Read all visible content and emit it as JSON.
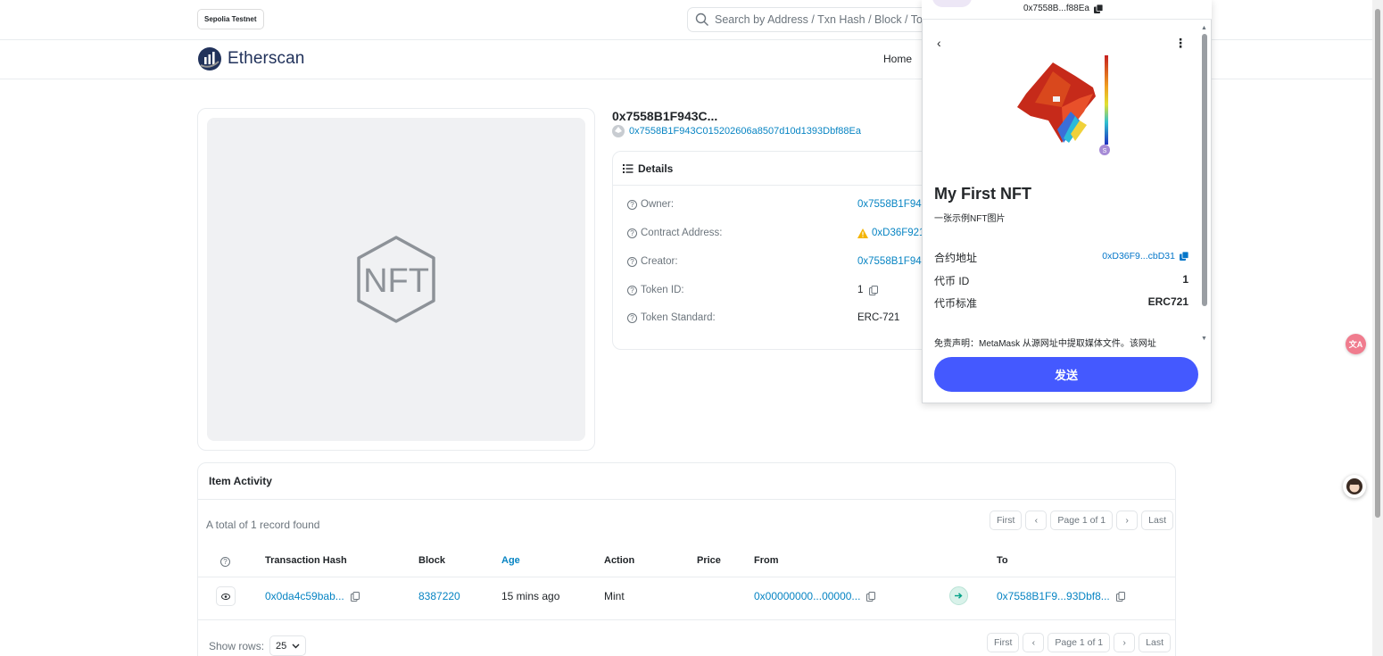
{
  "topbar": {
    "network_badge": "Sepolia Testnet",
    "search_placeholder": "Search by Address / Txn Hash / Block / Tok"
  },
  "header": {
    "logo_text": "Etherscan",
    "nav_home": "Home"
  },
  "token": {
    "name": "0x7558B1F943C...",
    "address": "0x7558B1F943C015202606a8507d10d1393Dbf88Ea",
    "placeholder_label": "NFT"
  },
  "details": {
    "title": "Details",
    "rows": [
      {
        "label": "Owner:",
        "value": "0x7558B1F94"
      },
      {
        "label": "Contract Address:",
        "value": "0xD36F921"
      },
      {
        "label": "Creator:",
        "value": "0x7558B1F94"
      },
      {
        "label": "Token ID:",
        "value": "1"
      },
      {
        "label": "Token Standard:",
        "value": "ERC-721"
      }
    ]
  },
  "activity": {
    "title": "Item Activity",
    "total": "A total of 1 record found",
    "pager": {
      "first": "First",
      "page": "Page 1 of 1",
      "last": "Last"
    },
    "columns": [
      "Transaction Hash",
      "Block",
      "Age",
      "Action",
      "Price",
      "From",
      "To"
    ],
    "rows": [
      {
        "tx_hash": "0x0da4c59bab...",
        "block": "8387220",
        "age": "15 mins ago",
        "action": "Mint",
        "price": "",
        "from": "0x00000000...00000...",
        "to": "0x7558B1F9...93Dbf8..."
      }
    ],
    "show_rows_label": "Show rows:",
    "show_rows_value": "25"
  },
  "metamask": {
    "account_short": "0x7558B...f88Ea",
    "nft_title": "My First NFT",
    "nft_desc": "一张示例NFT图片",
    "fields": [
      {
        "label": "合约地址",
        "value": "0xD36F9...cbD31"
      },
      {
        "label": "代币 ID",
        "value": "1"
      },
      {
        "label": "代币标准",
        "value": "ERC721"
      }
    ],
    "disclaimer": "免责声明：MetaMask 从源网址中提取媒体文件。该网址",
    "send_button": "发送"
  },
  "colors": {
    "link": "#0784c3",
    "metamask_primary": "#4459ff",
    "warning": "#f4b400"
  },
  "sidebar_widgets": {
    "translate_icon_text": "文A"
  }
}
